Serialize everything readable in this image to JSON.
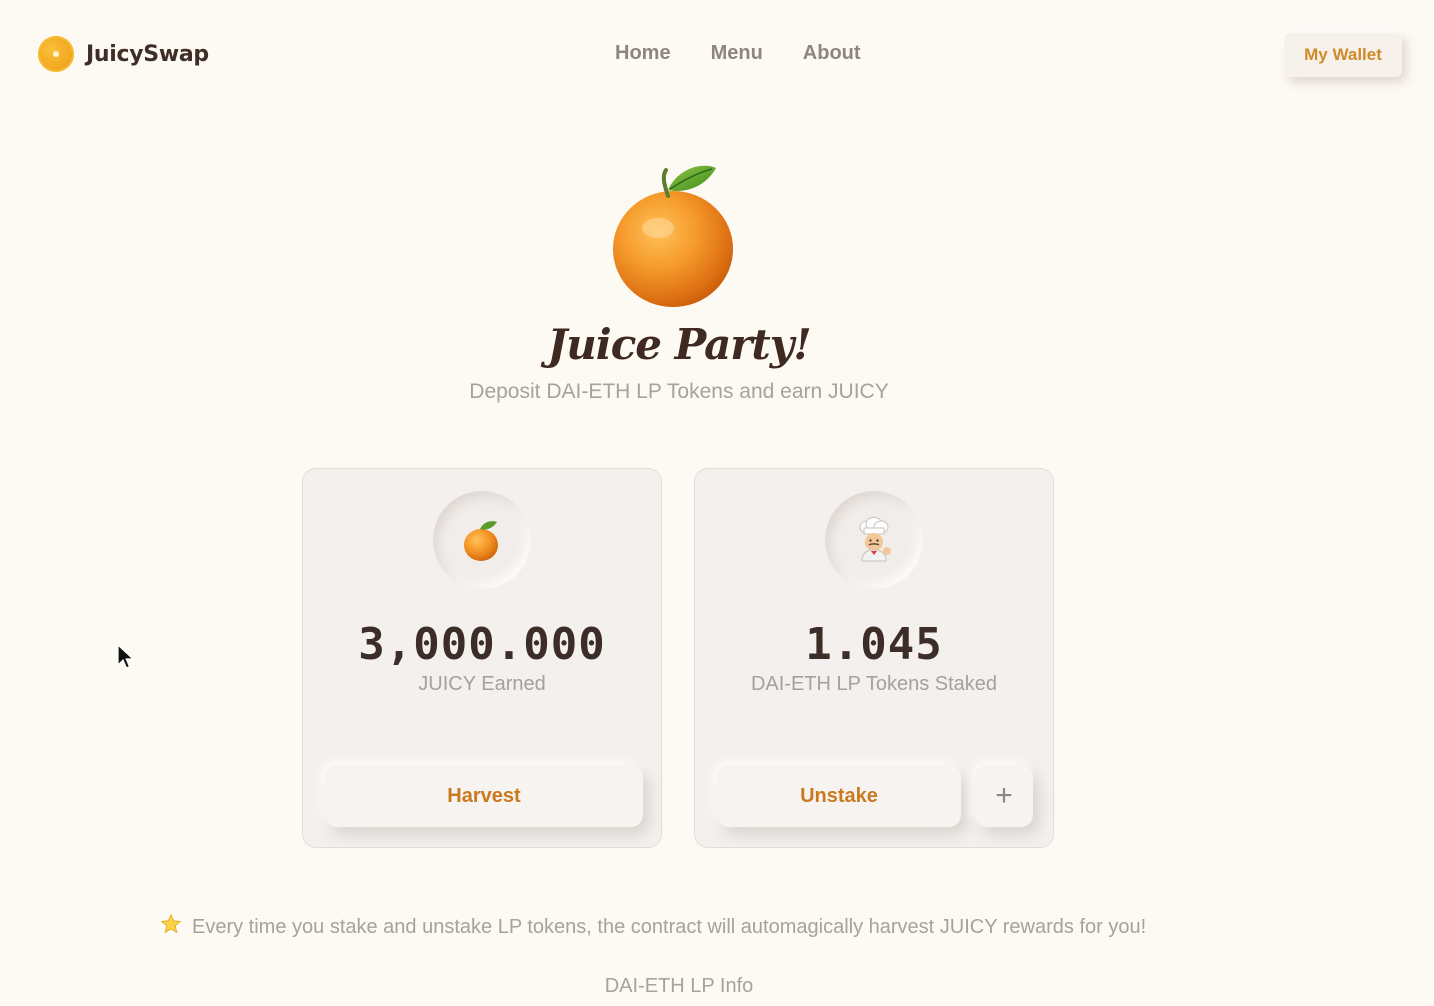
{
  "header": {
    "brand": "JuicySwap",
    "nav": [
      "Home",
      "Menu",
      "About"
    ],
    "wallet_label": "My Wallet"
  },
  "hero": {
    "title": "Juice Party!",
    "subtitle": "Deposit DAI-ETH LP Tokens and earn JUICY",
    "icon": "orange-icon"
  },
  "cards": {
    "earned": {
      "icon": "orange-icon",
      "value": "3,000.000",
      "label": "JUICY Earned",
      "button": "Harvest"
    },
    "staked": {
      "icon": "chef-icon",
      "value": "1.045",
      "label": "DAI-ETH LP Tokens Staked",
      "button": "Unstake",
      "plus": "+"
    }
  },
  "tip": {
    "icon": "star-icon",
    "text": "Every time you stake and unstake LP tokens, the contract will automagically harvest JUICY rewards for you!"
  },
  "footer": {
    "lp_info": "DAI-ETH LP Info"
  },
  "colors": {
    "background": "#fdf9f3",
    "accent": "#c97a1e",
    "text_dark": "#3c2d28",
    "text_muted": "#a8a19c"
  }
}
